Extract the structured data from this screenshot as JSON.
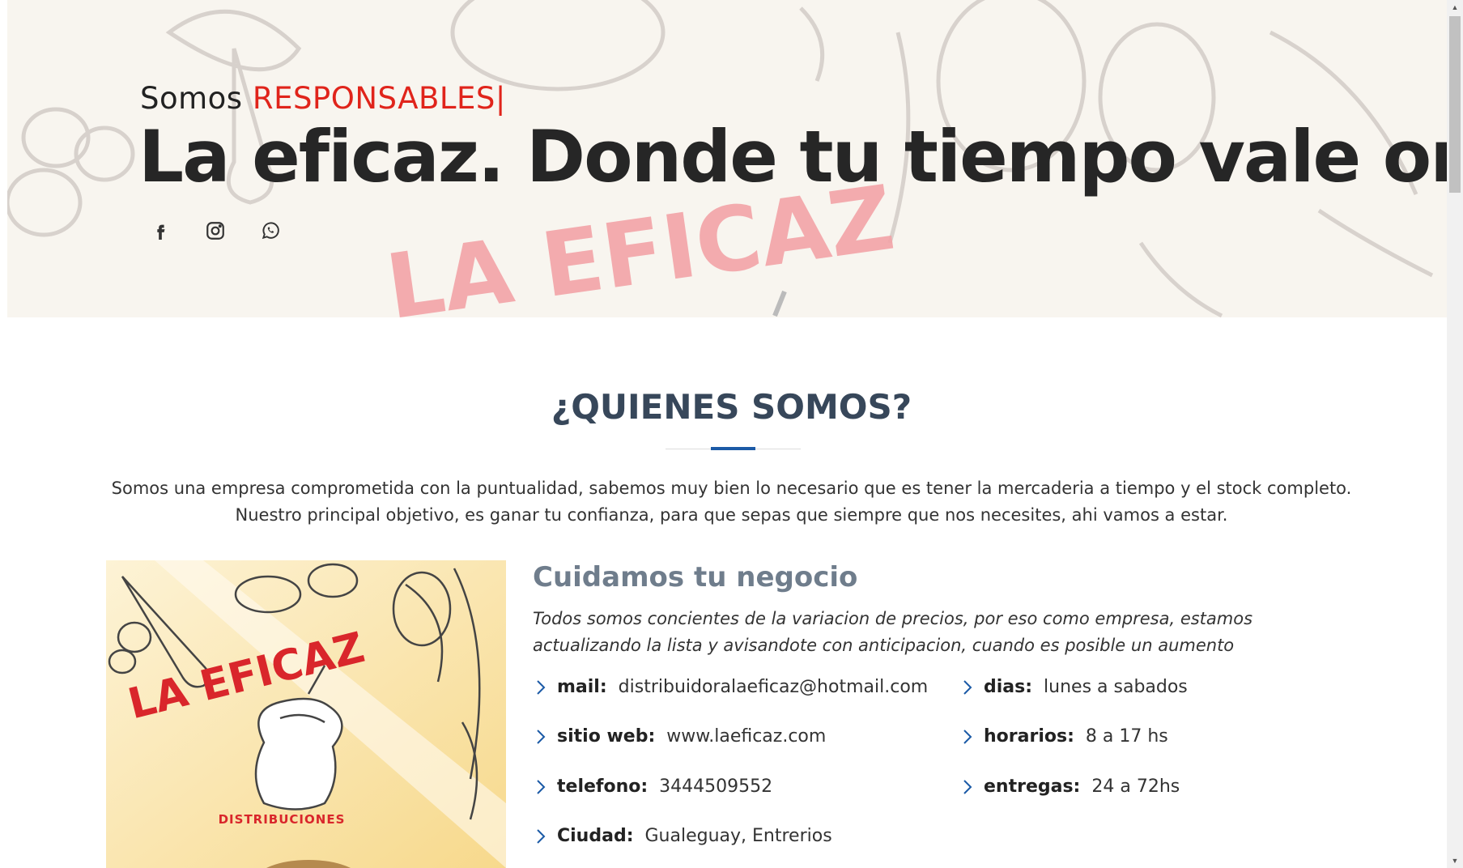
{
  "hero": {
    "prefix": "Somos",
    "highlight": "RESPONSABLES|",
    "title": "La eficaz. Donde tu tiempo vale oro",
    "watermark": "LA EFICAZ",
    "socials": [
      {
        "icon": "facebook-icon"
      },
      {
        "icon": "instagram-icon"
      },
      {
        "icon": "whatsapp-icon"
      }
    ]
  },
  "about": {
    "title": "¿QUIENES SOMOS?",
    "paragraph1": "Somos una empresa comprometida con la puntualidad, sabemos muy bien lo necesario que es tener la mercaderia a tiempo y el stock completo.",
    "paragraph2": "Nuestro principal objetivo, es ganar tu confianza, para que sepas que siempre que nos necesites, ahi vamos a estar."
  },
  "image": {
    "brand": "LA EFICAZ",
    "caption": "DISTRIBUCIONES"
  },
  "details": {
    "title": "Cuidamos tu negocio",
    "description": "Todos somos concientes de la variacion de precios, por eso como empresa, estamos actualizando la lista y avisandote con anticipacion, cuando es posible un aumento",
    "info": [
      {
        "key": "mail:",
        "value": "distribuidoralaeficaz@hotmail.com"
      },
      {
        "key": "sitio web:",
        "value": "www.laeficaz.com"
      },
      {
        "key": "telefono:",
        "value": "3444509552"
      },
      {
        "key": "Ciudad:",
        "value": "Gualeguay, Entrerios"
      },
      {
        "key": "dias:",
        "value": "lunes a sabados"
      },
      {
        "key": "horarios:",
        "value": "8 a 17 hs"
      },
      {
        "key": "entregas:",
        "value": "24 a 72hs"
      }
    ]
  },
  "colors": {
    "accent_red": "#e0241b",
    "divider_blue": "#1b5aa6",
    "heading_dark": "#37475a",
    "subheading_gray": "#6f7d8c"
  }
}
